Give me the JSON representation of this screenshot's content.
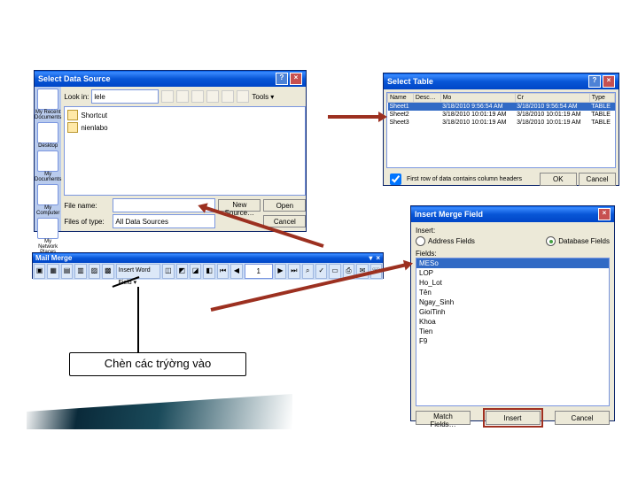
{
  "sds": {
    "title": "Select Data Source",
    "lookin_label": "Look in:",
    "lookin_value": "lele",
    "tools_label": "Tools ▾",
    "side": [
      "My Recent Documents",
      "Desktop",
      "My Documents",
      "My Computer",
      "My Network Places"
    ],
    "list": [
      "Shortcut",
      "nienlabo"
    ],
    "filename_label": "File name:",
    "filename_value": "",
    "filetype_label": "Files of type:",
    "filetype_value": "All Data Sources",
    "newsource_btn": "New Source…",
    "open_btn": "Open",
    "cancel_btn": "Cancel"
  },
  "st": {
    "title": "Select Table",
    "cols": [
      "Name",
      "Desc…",
      "Mo",
      "Cr",
      "Type"
    ],
    "rows": [
      [
        "Sheet1",
        "",
        "3/18/2010 9:56:54 AM",
        "3/18/2010 9:56:54 AM",
        "TABLE"
      ],
      [
        "Sheet2",
        "",
        "3/18/2010 10:01:19 AM",
        "3/18/2010 10:01:19 AM",
        "TABLE"
      ],
      [
        "Sheet3",
        "",
        "3/18/2010 10:01:19 AM",
        "3/18/2010 10:01:19 AM",
        "TABLE"
      ]
    ],
    "chk_label": "First row of data contains column headers",
    "ok_btn": "OK",
    "cancel_btn": "Cancel"
  },
  "imf": {
    "title": "Insert Merge Field",
    "insert_label": "Insert:",
    "radio1": "Address Fields",
    "radio2": "Database Fields",
    "fields_label": "Fields:",
    "fields": [
      "MESo",
      "LOP",
      "Ho_Lot",
      "Tên",
      "Ngay_Sinh",
      "GioiTinh",
      "Khoa",
      "Tien",
      "F9"
    ],
    "match_btn": "Match Fields…",
    "insert_btn": "Insert",
    "cancel_btn": "Cancel"
  },
  "mm": {
    "title": "Mail Merge",
    "insertword_label": "Insert Word Field ▾",
    "record": "1"
  },
  "callout": "Chèn các trýờng vào"
}
